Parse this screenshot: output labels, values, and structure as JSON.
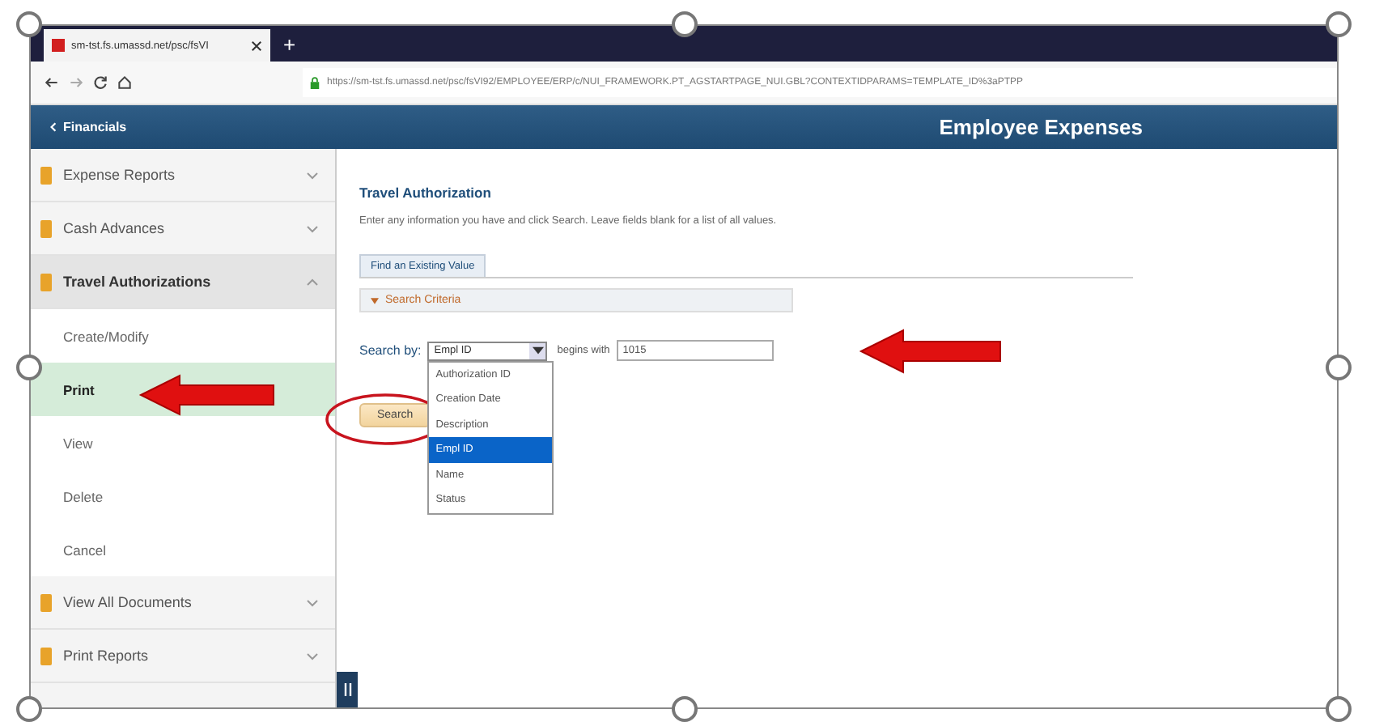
{
  "browser": {
    "tab_title": "sm-tst.fs.umassd.net/psc/fsVI",
    "new_tab": "+",
    "url": "https://sm-tst.fs.umassd.net/psc/fsVI92/EMPLOYEE/ERP/c/NUI_FRAMEWORK.PT_AGSTARTPAGE_NUI.GBL?CONTEXTIDPARAMS=TEMPLATE_ID%3aPTPP"
  },
  "header": {
    "back": "Financials",
    "title": "Employee Expenses"
  },
  "sidebar": {
    "items": [
      {
        "label": "Expense Reports",
        "expanded": false
      },
      {
        "label": "Cash Advances",
        "expanded": false
      },
      {
        "label": "Travel Authorizations",
        "expanded": true,
        "children": [
          {
            "label": "Create/Modify",
            "selected": false
          },
          {
            "label": "Print",
            "selected": true
          },
          {
            "label": "View",
            "selected": false
          },
          {
            "label": "Delete",
            "selected": false
          },
          {
            "label": "Cancel",
            "selected": false
          }
        ]
      },
      {
        "label": "View All Documents",
        "expanded": false
      },
      {
        "label": "Print Reports",
        "expanded": false
      }
    ]
  },
  "content": {
    "title": "Travel Authorization",
    "instructions": "Enter any information you have and click Search. Leave fields blank for a list of all values.",
    "tab": "Find an Existing Value",
    "section": {
      "label": "Search Criteria",
      "expanded": true
    },
    "search_by_label": "Search by:",
    "search_by_value": "Empl ID",
    "operator": "begins with",
    "value": "1015",
    "dropdown_options": [
      {
        "label": "Authorization ID",
        "selected": false
      },
      {
        "label": "Creation Date",
        "selected": false
      },
      {
        "label": "Description",
        "selected": false
      },
      {
        "label": "Empl ID",
        "selected": true
      },
      {
        "label": "Name",
        "selected": false
      },
      {
        "label": "Status",
        "selected": false
      }
    ],
    "search_button": "Search"
  }
}
